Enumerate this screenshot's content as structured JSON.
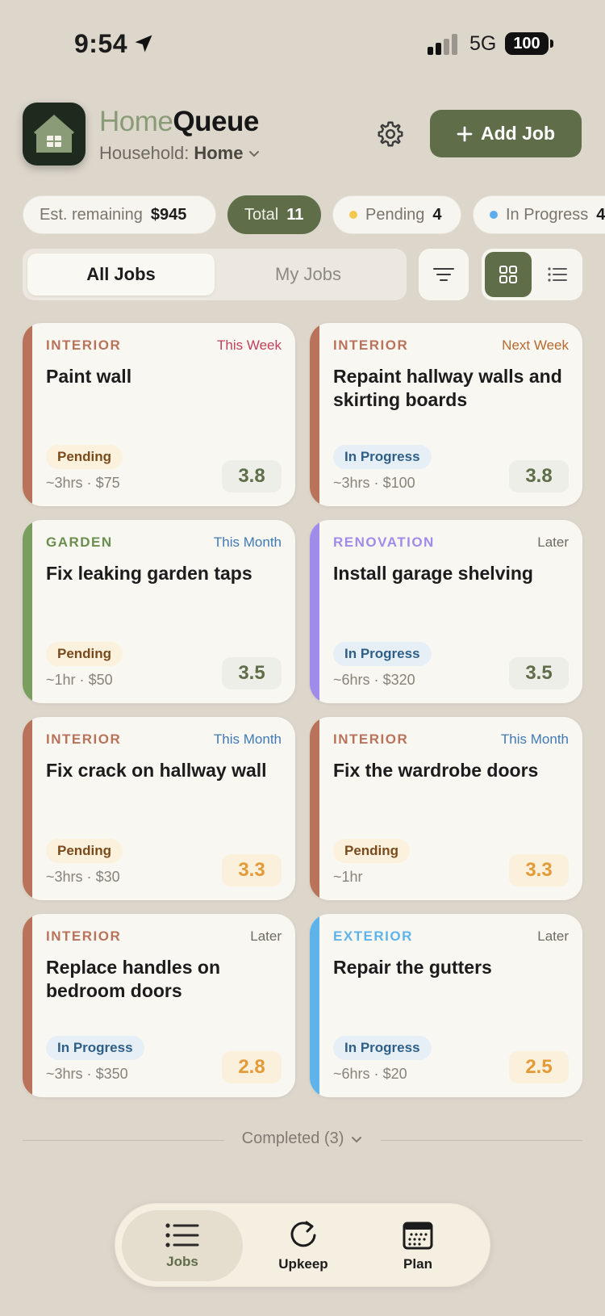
{
  "status_bar": {
    "time": "9:54",
    "network": "5G",
    "battery": "100"
  },
  "header": {
    "brand_light": "Home",
    "brand_dark": "Queue",
    "household_label": "Household:",
    "household_value": "Home",
    "add_button": "Add Job"
  },
  "stats": [
    {
      "label": "Est. remaining",
      "value": "$945"
    },
    {
      "label": "Total",
      "value": "11"
    },
    {
      "label": "Pending",
      "value": "4",
      "dot": "#F2C94C"
    },
    {
      "label": "In Progress",
      "value": "4",
      "dot": "#5DADEC"
    }
  ],
  "segments": {
    "all": "All Jobs",
    "mine": "My Jobs"
  },
  "jobs": [
    {
      "category": "INTERIOR",
      "when": "This Week",
      "title": "Paint wall",
      "status": "Pending",
      "duration": "~3hrs",
      "cost": "$75",
      "score": "3.8"
    },
    {
      "category": "INTERIOR",
      "when": "Next Week",
      "title": "Repaint hallway walls and skirting boards",
      "status": "In Progress",
      "duration": "~3hrs",
      "cost": "$100",
      "score": "3.8"
    },
    {
      "category": "GARDEN",
      "when": "This Month",
      "title": "Fix leaking garden taps",
      "status": "Pending",
      "duration": "~1hr",
      "cost": "$50",
      "score": "3.5"
    },
    {
      "category": "RENOVATION",
      "when": "Later",
      "title": "Install garage shelving",
      "status": "In Progress",
      "duration": "~6hrs",
      "cost": "$320",
      "score": "3.5"
    },
    {
      "category": "INTERIOR",
      "when": "This Month",
      "title": "Fix crack on hallway wall",
      "status": "Pending",
      "duration": "~3hrs",
      "cost": "$30",
      "score": "3.3"
    },
    {
      "category": "INTERIOR",
      "when": "This Month",
      "title": "Fix the wardrobe doors",
      "status": "Pending",
      "duration": "~1hr",
      "cost": "",
      "score": "3.3"
    },
    {
      "category": "INTERIOR",
      "when": "Later",
      "title": "Replace handles on bedroom doors",
      "status": "In Progress",
      "duration": "~3hrs",
      "cost": "$350",
      "score": "2.8"
    },
    {
      "category": "EXTERIOR",
      "when": "Later",
      "title": "Repair the gutters",
      "status": "In Progress",
      "duration": "~6hrs",
      "cost": "$20",
      "score": "2.5"
    }
  ],
  "meta_separator": "·",
  "completed_label": "Completed (3)",
  "tabs": {
    "jobs": "Jobs",
    "upkeep": "Upkeep",
    "plan": "Plan"
  },
  "colors": {
    "accent": "#5F6E49",
    "interior": "#B8735A",
    "garden": "#7A9E5E",
    "renovation": "#A18BEA",
    "exterior": "#5DB3EA",
    "this_week": "#C0415A",
    "next_week": "#B76A2E",
    "this_month": "#3F7AB5",
    "later": "#6E6A62"
  }
}
